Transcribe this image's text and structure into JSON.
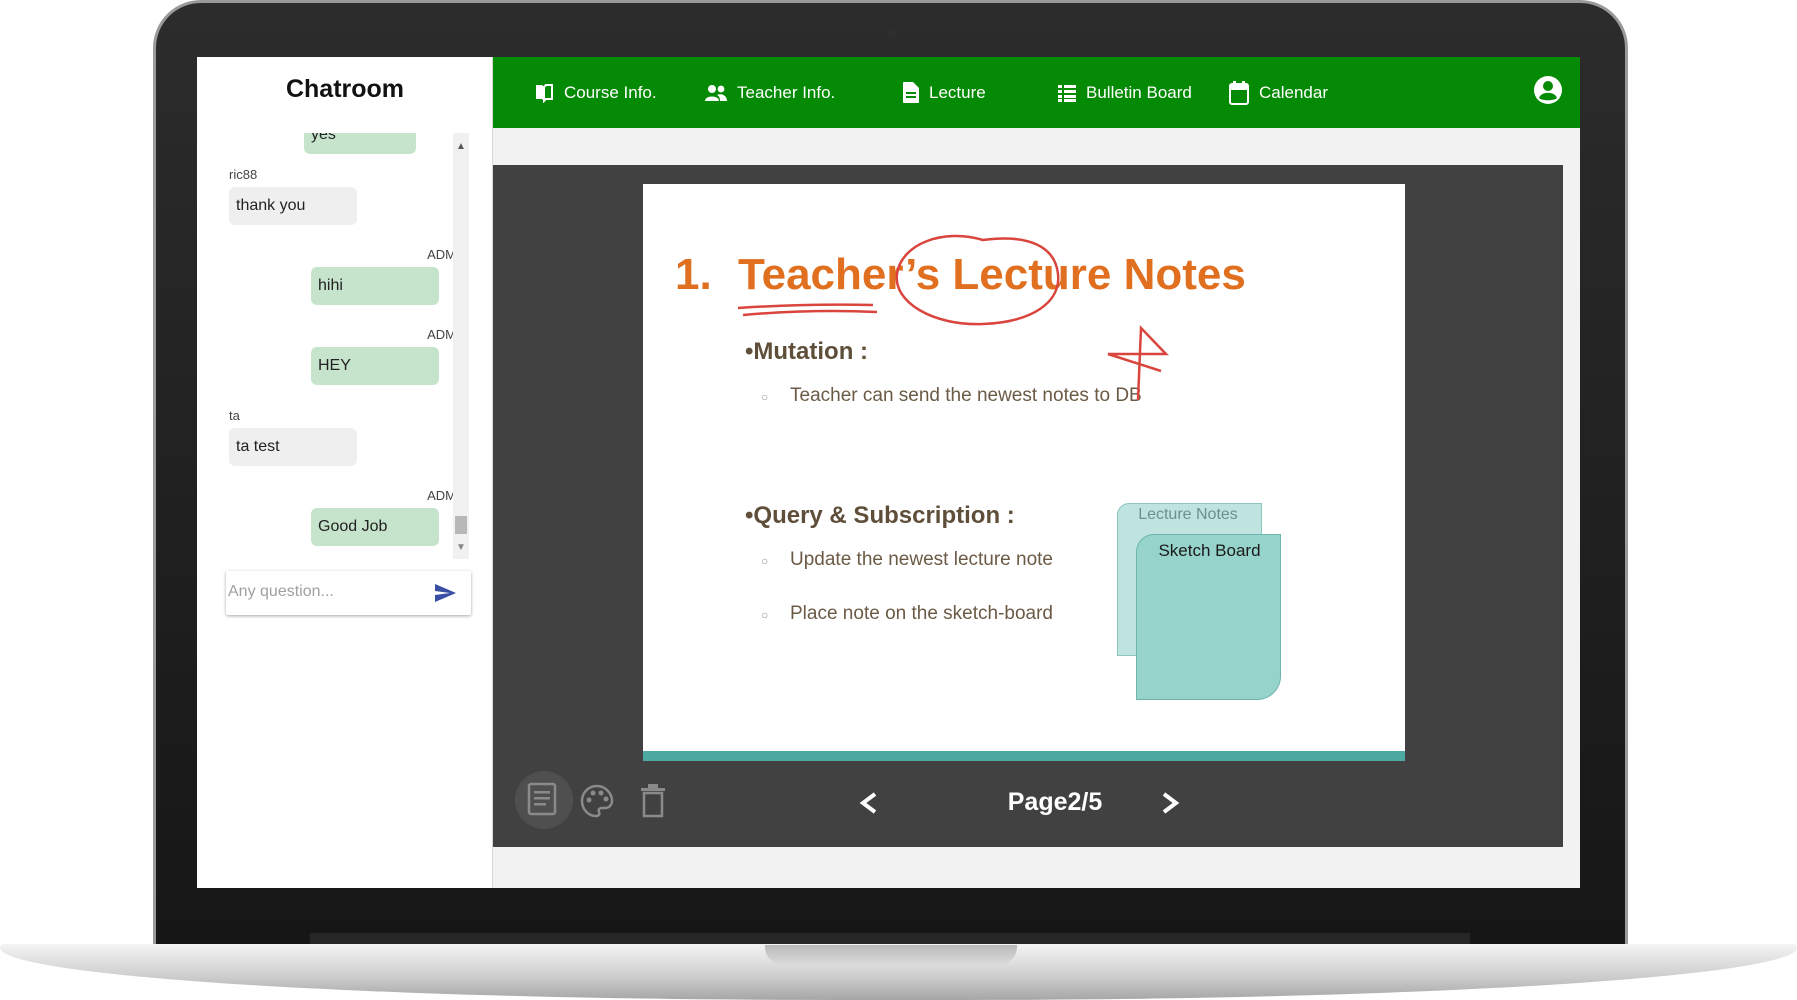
{
  "chat": {
    "title": "Chatroom",
    "messages": [
      {
        "sender": "",
        "text": "yes",
        "from_admin": true
      },
      {
        "sender": "ric88",
        "text": "thank you",
        "from_admin": false
      },
      {
        "sender": "ADMIN",
        "text": "hihi",
        "from_admin": true
      },
      {
        "sender": "ADMIN",
        "text": "HEY",
        "from_admin": true
      },
      {
        "sender": "ta",
        "text": "ta test",
        "from_admin": false
      },
      {
        "sender": "ADMIN",
        "text": "Good Job",
        "from_admin": true
      }
    ],
    "input_placeholder": "Any question..."
  },
  "nav": {
    "items": [
      {
        "label": "Course Info.",
        "icon": "book-icon"
      },
      {
        "label": "Teacher Info.",
        "icon": "people-icon"
      },
      {
        "label": "Lecture",
        "icon": "document-icon"
      },
      {
        "label": "Bulletin Board",
        "icon": "list-icon"
      },
      {
        "label": "Calendar",
        "icon": "calendar-icon"
      }
    ],
    "user_icon": "account-icon"
  },
  "slide": {
    "number": "1.",
    "title": "Teacher’s Lecture Notes",
    "sections": [
      {
        "heading": "•Mutation :",
        "bullets": [
          "Teacher can send the newest notes to DB"
        ]
      },
      {
        "heading": "•Query & Subscription :",
        "bullets": [
          "Update the newest  lecture note",
          "Place note on the sketch-board"
        ]
      }
    ],
    "diagram": {
      "back_label": "Lecture Notes",
      "front_label": "Sketch Board"
    },
    "bullet_marker": "○",
    "colors": {
      "title": "#e07020",
      "accent_bar": "#4ea9a3",
      "ink": "#d9453c"
    }
  },
  "viewer": {
    "tools": [
      "notes-icon",
      "palette-icon",
      "trash-icon"
    ],
    "prev_label": "<",
    "next_label": ">",
    "page_label": "Page2/5"
  },
  "colors": {
    "nav": "#058a05",
    "viewer_bg": "#414141",
    "admin_bubble": "#c6e3cc"
  }
}
